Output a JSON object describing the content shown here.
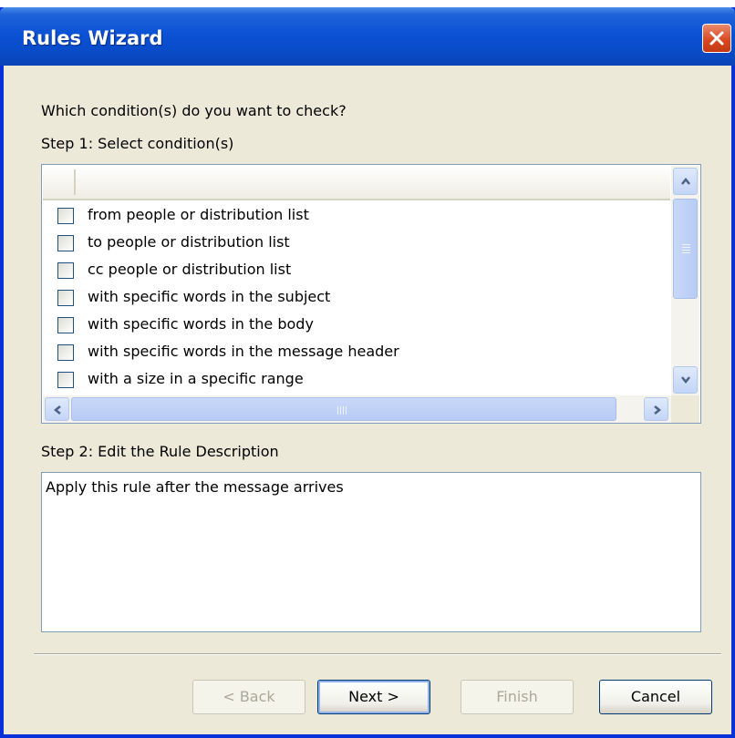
{
  "window": {
    "title": "Rules Wizard",
    "close_label": "Close"
  },
  "prompt": "Which condition(s) do you want to check?",
  "step1": {
    "label": "Step 1: Select condition(s)",
    "items": [
      {
        "label": "from people or distribution list",
        "checked": false
      },
      {
        "label": "to people or distribution list",
        "checked": false
      },
      {
        "label": "cc people or distribution list",
        "checked": false
      },
      {
        "label": "with specific words in the subject",
        "checked": false
      },
      {
        "label": "with specific words in the body",
        "checked": false
      },
      {
        "label": "with specific words in the message header",
        "checked": false
      },
      {
        "label": "with a size in a specific range",
        "checked": false
      }
    ]
  },
  "step2": {
    "label": "Step 2: Edit the Rule Description",
    "description": "Apply this rule after the message arrives"
  },
  "buttons": {
    "back": "< Back",
    "next": "Next >",
    "finish": "Finish",
    "cancel": "Cancel"
  },
  "colors": {
    "titlebar": "#0a4bc8",
    "dialog_bg": "#ece9d8",
    "close_button": "#d8461e",
    "field_border": "#7f9db9"
  }
}
